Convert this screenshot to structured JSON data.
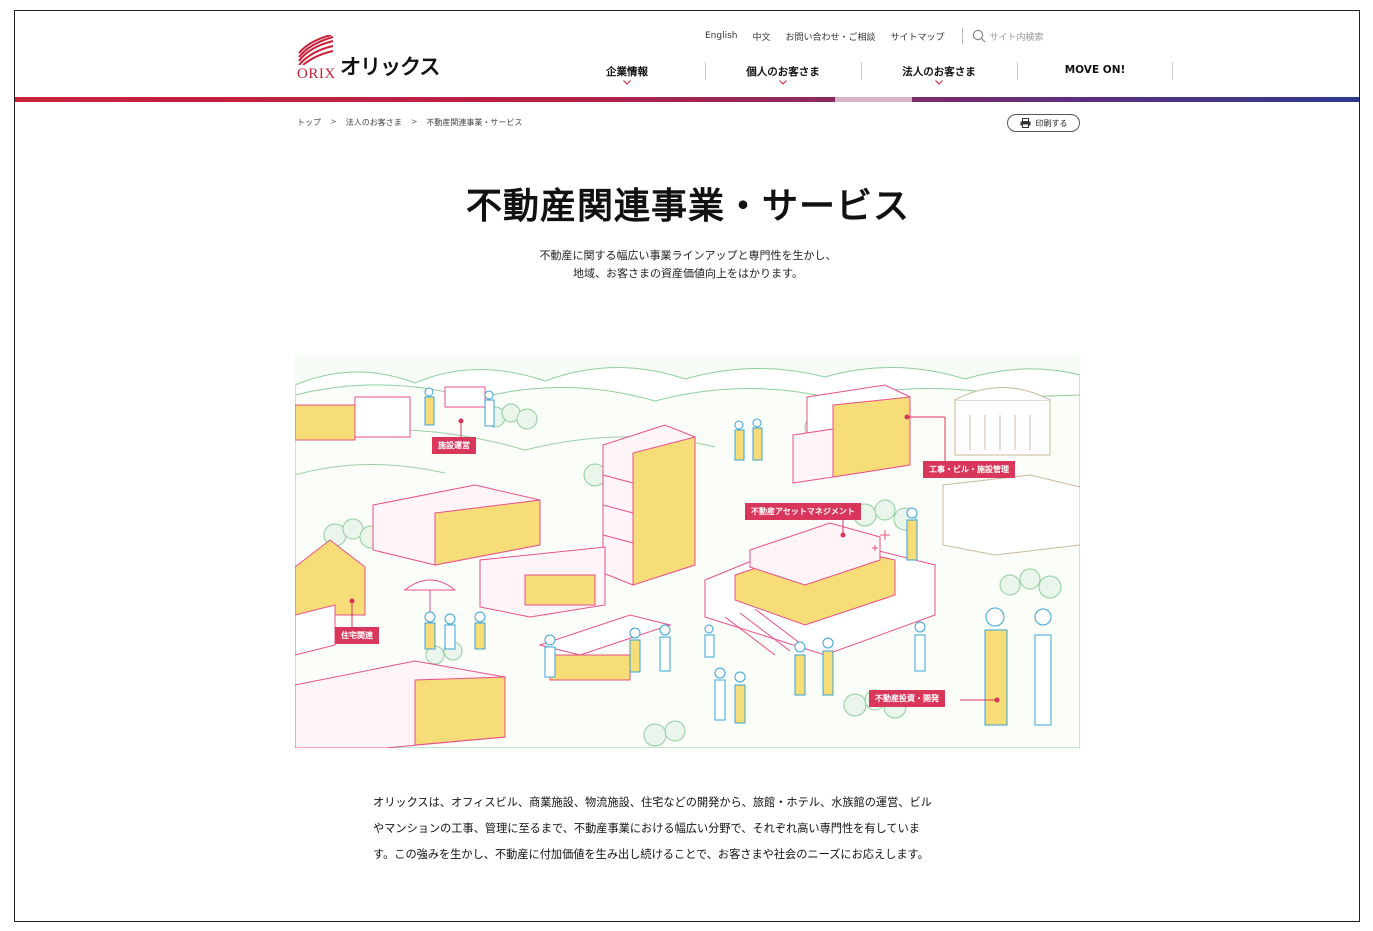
{
  "logo": {
    "brand_latin": "ORIX",
    "brand_kana": "オリックス"
  },
  "utility_nav": {
    "links": [
      "English",
      "中文",
      "お問い合わせ・ご相談",
      "サイトマップ"
    ],
    "search_placeholder": "サイト内検索"
  },
  "global_nav": {
    "items": [
      {
        "label": "企業情報",
        "has_menu": true
      },
      {
        "label": "個人のお客さま",
        "has_menu": true
      },
      {
        "label": "法人のお客さま",
        "has_menu": true,
        "current": true
      },
      {
        "label": "MOVE ON!",
        "has_menu": false
      }
    ]
  },
  "breadcrumb": {
    "items": [
      "トップ",
      "法人のお客さま",
      "不動産関連事業・サービス"
    ],
    "separator": ">"
  },
  "print_button": {
    "label": "印刷する"
  },
  "page": {
    "title": "不動産関連事業・サービス",
    "lead_line1": "不動産に関する幅広い事業ラインアップと専門性を生かし、",
    "lead_line2": "地域、お客さまの資産価値向上をはかります。"
  },
  "illustration": {
    "tags": [
      "施設運営",
      "工事・ビル・施設管理",
      "不動産アセットマネジメント",
      "住宅関連",
      "不動産投資・開発"
    ]
  },
  "body": {
    "line1": "オリックスは、オフィスビル、商業施設、物流施設、住宅などの開発から、旅館・ホテル、水族館の運営、ビル",
    "line2": "やマンションの工事、管理に至るまで、不動産事業における幅広い分野で、それぞれ高い専門性を有していま",
    "line3": "す。この強みを生かし、不動産に付加価値を生み出し続けることで、お客さまや社会のニーズにお応えします。"
  },
  "colors": {
    "brand_red": "#c8213b",
    "tag_pink": "#d8365b",
    "illus_yellow": "#f6dd78",
    "illus_pink": "#e8508a",
    "illus_green": "#8fce9e",
    "illus_blue": "#3aa3d6"
  }
}
